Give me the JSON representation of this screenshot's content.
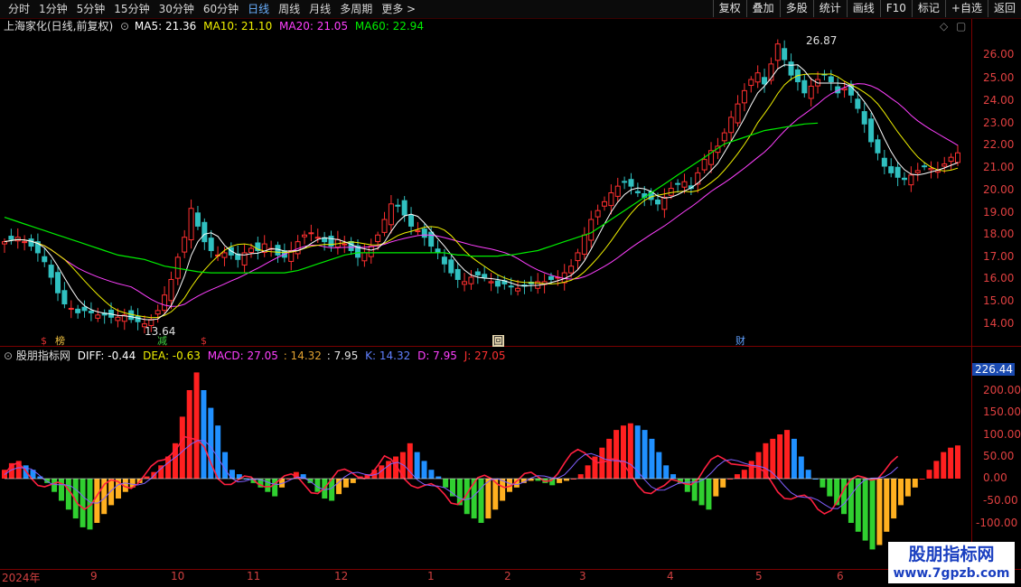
{
  "toolbar": {
    "periods": [
      "分时",
      "1分钟",
      "5分钟",
      "15分钟",
      "30分钟",
      "60分钟",
      "日线",
      "周线",
      "月线",
      "多周期",
      "更多 >"
    ],
    "active_period": "日线",
    "actions": [
      "复权",
      "叠加",
      "多股",
      "统计",
      "画线",
      "F10",
      "标记",
      "+自选",
      "返回"
    ]
  },
  "main_chart": {
    "title": "上海家化(日线,前复权)",
    "ma5": "MA5: 21.36",
    "ma10": "MA10: 21.10",
    "ma20": "MA20: 21.05",
    "ma60": "MA60: 22.94",
    "high_label": "26.87",
    "low_label": "13.64",
    "y_ticks": [
      "26.00",
      "25.00",
      "24.00",
      "23.00",
      "22.00",
      "21.00",
      "20.00",
      "19.00",
      "18.00",
      "17.00",
      "16.00",
      "15.00",
      "14.00"
    ],
    "markers": [
      {
        "text": "$",
        "color": "#e03030"
      },
      {
        "text": "榜",
        "color": "#f0c040"
      },
      {
        "text": "减",
        "color": "#40d040"
      },
      {
        "text": "$",
        "color": "#e03030"
      },
      {
        "text": "回",
        "color": "#e8d8b0"
      },
      {
        "text": "财",
        "color": "#60a0ff"
      }
    ]
  },
  "indicator": {
    "name": "股朋指标网",
    "diff": "DIFF: -0.44",
    "dea": "DEA: -0.63",
    "macd": "MACD: 27.05",
    "v1": ": 14.32",
    "v2": ": 7.95",
    "k": "K: 14.32",
    "d": "D: 7.95",
    "j": "J: 27.05",
    "current_value": "226.44",
    "y_ticks": [
      "200.00",
      "150.00",
      "100.00",
      "50.00",
      "0.00",
      "-50.00",
      "-100.00"
    ]
  },
  "x_axis": [
    "2024年",
    "9",
    "10",
    "11",
    "12",
    "1",
    "2",
    "3",
    "4",
    "5",
    "6"
  ],
  "watermark": {
    "title": "股朋指标网",
    "url": "www.7gpzb.com"
  },
  "colors": {
    "up": "#ff3030",
    "down": "#30c0c0",
    "ma5": "#ffffff",
    "ma10": "#f0f000",
    "ma20": "#ff40ff",
    "ma60": "#00ee00"
  },
  "chart_data": {
    "type": "line",
    "price_range": [
      13.64,
      26.87
    ],
    "close": [
      17.6,
      17.7,
      17.8,
      17.6,
      17.4,
      17.1,
      16.7,
      16.0,
      15.3,
      14.8,
      14.6,
      14.4,
      14.5,
      14.4,
      14.3,
      14.3,
      14.2,
      14.2,
      14.3,
      14.1,
      14.0,
      13.9,
      14.1,
      14.5,
      15.2,
      15.9,
      16.9,
      17.8,
      19.1,
      18.3,
      17.6,
      17.2,
      17.0,
      17.1,
      17.0,
      16.8,
      17.1,
      17.3,
      17.2,
      17.5,
      17.3,
      17.0,
      16.9,
      17.2,
      17.6,
      17.9,
      18.0,
      17.8,
      17.6,
      17.4,
      17.7,
      17.5,
      17.2,
      16.9,
      17.1,
      17.4,
      17.9,
      18.6,
      19.3,
      19.2,
      18.8,
      18.3,
      18.1,
      17.8,
      17.4,
      17.1,
      16.6,
      16.2,
      15.9,
      15.8,
      16.0,
      16.1,
      16.0,
      15.8,
      15.6,
      15.7,
      15.6,
      15.5,
      15.6,
      15.7,
      15.8,
      15.8,
      15.9,
      16.0,
      16.2,
      16.5,
      17.1,
      17.9,
      18.6,
      19.0,
      19.4,
      19.8,
      20.1,
      20.3,
      20.1,
      19.8,
      19.6,
      19.5,
      19.3,
      19.6,
      20.0,
      20.2,
      20.3,
      20.0,
      20.7,
      21.3,
      21.7,
      21.9,
      22.5,
      23.2,
      23.8,
      24.4,
      24.9,
      25.2,
      24.7,
      25.6,
      26.5,
      25.8,
      25.1,
      24.8,
      24.3,
      24.6,
      24.9,
      25.1,
      24.8,
      24.3,
      24.5,
      24.2,
      23.6,
      22.9,
      22.1,
      21.6,
      21.0,
      20.7,
      20.5,
      20.4,
      20.6,
      20.8,
      21.0,
      20.9,
      20.8,
      21.1,
      21.4,
      21.6
    ],
    "ma60": [
      18.7,
      18.6,
      18.5,
      18.4,
      18.3,
      18.2,
      18.1,
      18.0,
      17.9,
      17.8,
      17.7,
      17.6,
      17.5,
      17.4,
      17.3,
      17.2,
      17.1,
      17.0,
      16.95,
      16.9,
      16.85,
      16.8,
      16.7,
      16.6,
      16.5,
      16.45,
      16.4,
      16.35,
      16.3,
      16.25,
      16.22,
      16.2,
      16.2,
      16.2,
      16.2,
      16.2,
      16.2,
      16.2,
      16.2,
      16.2,
      16.2,
      16.2,
      16.2,
      16.25,
      16.3,
      16.4,
      16.5,
      16.6,
      16.7,
      16.8,
      16.9,
      17.0,
      17.05,
      17.1,
      17.1,
      17.1,
      17.1,
      17.1,
      17.1,
      17.1,
      17.1,
      17.1,
      17.1,
      17.1,
      17.1,
      17.1,
      17.1,
      17.05,
      17.0,
      17.0,
      16.95,
      16.95,
      16.95,
      16.95,
      16.95,
      17.0,
      17.0,
      17.05,
      17.1,
      17.15,
      17.2,
      17.3,
      17.4,
      17.5,
      17.6,
      17.7,
      17.8,
      17.9,
      18.0,
      18.2,
      18.4,
      18.6,
      18.8,
      19.0,
      19.2,
      19.4,
      19.6,
      19.8,
      20.0,
      20.2,
      20.4,
      20.6,
      20.8,
      21.0,
      21.2,
      21.4,
      21.6,
      21.8,
      22.0,
      22.1,
      22.2,
      22.3,
      22.4,
      22.5,
      22.6,
      22.65,
      22.7,
      22.75,
      22.8,
      22.85,
      22.9,
      22.92,
      22.94
    ],
    "macd_hist": [
      20,
      35,
      40,
      30,
      20,
      5,
      -10,
      -30,
      -50,
      -70,
      -90,
      -110,
      -115,
      -100,
      -80,
      -60,
      -45,
      -30,
      -20,
      -10,
      5,
      15,
      30,
      50,
      80,
      140,
      200,
      240,
      200,
      160,
      120,
      60,
      20,
      10,
      0,
      -10,
      -20,
      -30,
      -40,
      -20,
      0,
      15,
      10,
      -10,
      -30,
      -45,
      -50,
      -35,
      -20,
      -10,
      5,
      10,
      20,
      30,
      40,
      50,
      60,
      80,
      60,
      40,
      20,
      5,
      -20,
      -40,
      -60,
      -80,
      -90,
      -100,
      -90,
      -70,
      -50,
      -30,
      -20,
      -10,
      -5,
      -5,
      -10,
      -15,
      -10,
      -5,
      0,
      10,
      30,
      50,
      70,
      90,
      110,
      120,
      125,
      120,
      110,
      90,
      60,
      30,
      10,
      -10,
      -30,
      -50,
      -60,
      -70,
      -40,
      -20,
      0,
      10,
      20,
      40,
      60,
      80,
      90,
      100,
      110,
      90,
      50,
      20,
      0,
      -20,
      -40,
      -60,
      -80,
      -100,
      -120,
      -140,
      -160,
      -150,
      -120,
      -90,
      -60,
      -40,
      -20,
      0,
      20,
      40,
      60,
      70,
      75
    ]
  }
}
